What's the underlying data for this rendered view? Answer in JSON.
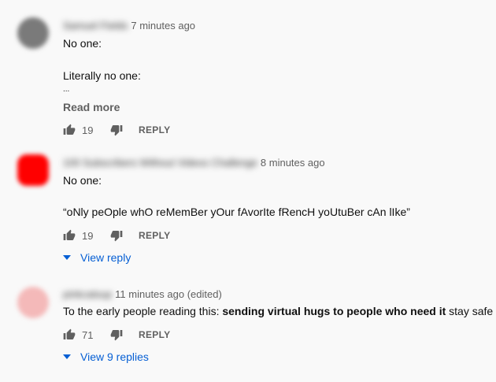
{
  "comments": [
    {
      "author": "Samuel Fields",
      "time": "7 minutes ago",
      "lines": [
        "No one:",
        "Literally no one:",
        "..."
      ],
      "read_more": "Read more",
      "likes": "19",
      "reply_label": "REPLY",
      "avatar_color": "#7a7a7a"
    },
    {
      "author": "100 Subscribers Without Videos Challenge",
      "time": "8 minutes ago",
      "lines": [
        "No one:",
        "“oNly peOple whO reMemBer yOur fAvorIte fRencH yoUtuBer cAn lIke”"
      ],
      "likes": "19",
      "reply_label": "REPLY",
      "view_replies": "View reply",
      "avatar_color": "#ff0000"
    },
    {
      "author": "pinkcatsup",
      "time": "11 minutes ago (edited)",
      "text_pre": "To the early people reading this: ",
      "text_bold": "sending virtual hugs to people who need it",
      "text_post": " stay safe",
      "likes": "71",
      "reply_label": "REPLY",
      "view_replies": "View 9 replies",
      "avatar_color": "#f4b9b9"
    }
  ]
}
